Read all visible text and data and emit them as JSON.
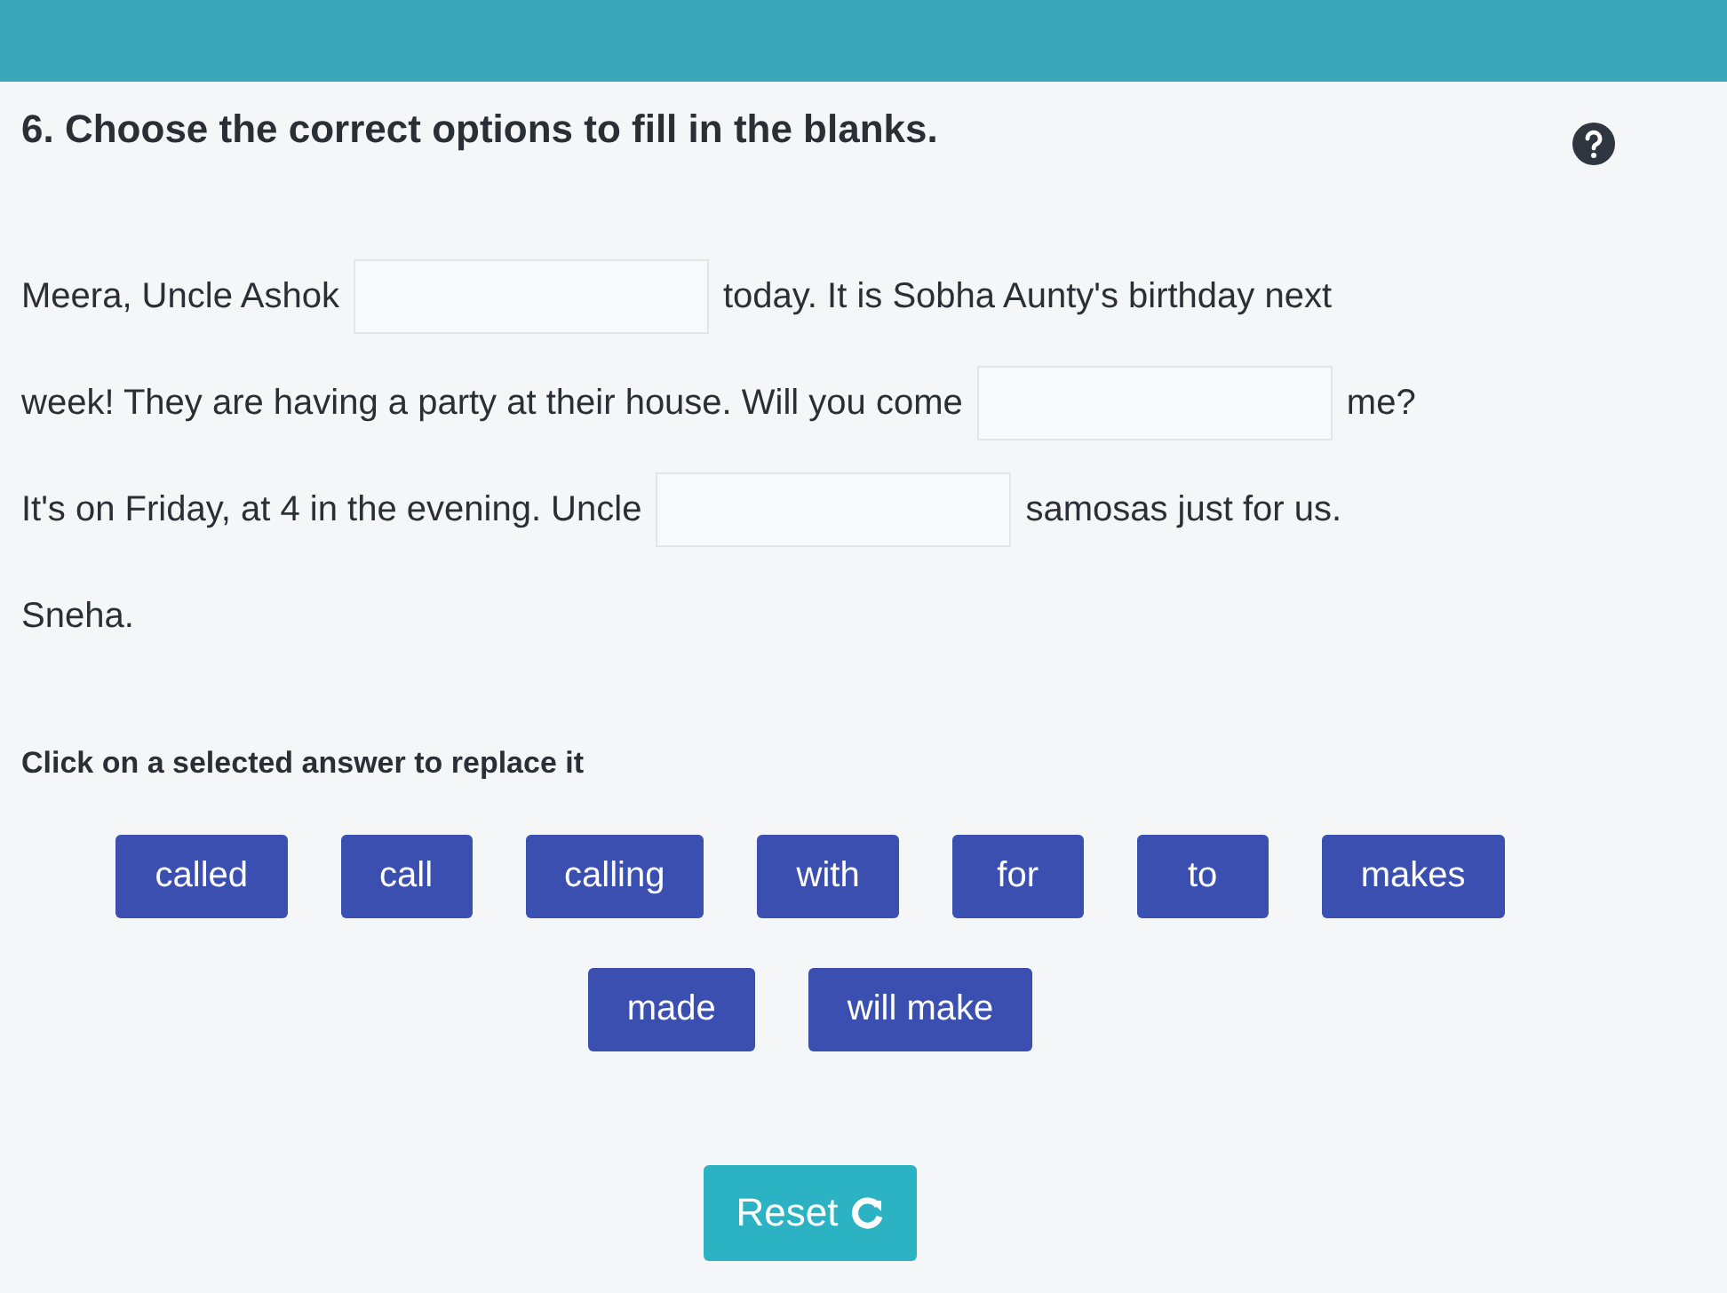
{
  "question": {
    "number": "6.",
    "title": "Choose the correct options to fill in the blanks."
  },
  "passage": [
    [
      {
        "kind": "text",
        "text": "Meera, Uncle Ashok"
      },
      {
        "kind": "blank"
      },
      {
        "kind": "text",
        "text": "today. It is Sobha Aunty's birthday next"
      }
    ],
    [
      {
        "kind": "text",
        "text": "week! They are having a party at their house. Will you come"
      },
      {
        "kind": "blank"
      },
      {
        "kind": "text",
        "text": "me?"
      }
    ],
    [
      {
        "kind": "text",
        "text": "It's on Friday, at 4 in the evening. Uncle"
      },
      {
        "kind": "blank"
      },
      {
        "kind": "text",
        "text": "samosas just for us."
      }
    ],
    [
      {
        "kind": "text",
        "text": "Sneha."
      }
    ]
  ],
  "instruction": "Click on a selected answer to replace it",
  "options": [
    "called",
    "call",
    "calling",
    "with",
    "for",
    "to",
    "makes",
    "made",
    "will make"
  ],
  "reset_button": "Reset"
}
